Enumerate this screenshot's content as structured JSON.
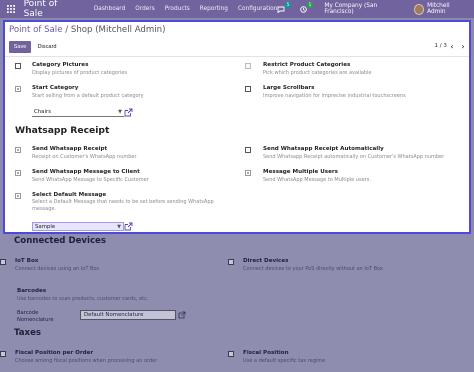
{
  "navbar": {
    "brand": "Point of Sale",
    "menu": [
      "Dashboard",
      "Orders",
      "Products",
      "Reporting",
      "Configuration"
    ],
    "messages_count": "5",
    "activities_count": "1",
    "company": "My Company (San Francisco)",
    "user": "Mitchell Admin"
  },
  "dialog": {
    "breadcrumb_parent": "Point of Sale",
    "breadcrumb_sep": "/",
    "breadcrumb_current": "Shop (Mitchell Admin)",
    "save_label": "Save",
    "discard_label": "Discard",
    "pager": "1 / 3",
    "settings": {
      "category_pictures": {
        "title": "Category Pictures",
        "desc": "Display pictures of product categories"
      },
      "restrict_categories": {
        "title": "Restrict Product Categories",
        "desc": "Pick which product categories are available"
      },
      "start_category": {
        "title": "Start Category",
        "desc": "Start selling from a default product category",
        "value": "Chairs"
      },
      "large_scrollbars": {
        "title": "Large Scrollbars",
        "desc": "Improve navigation for imprecise industrial touchscreens"
      }
    },
    "whatsapp": {
      "heading": "Whatsapp Receipt",
      "send_receipt": {
        "title": "Send Whatsapp Receipt",
        "desc": "Receipt on Customer's WhatsApp number"
      },
      "send_auto": {
        "title": "Send Whatsapp Receipt Automatically",
        "desc": "Send Whatsapp Receipt automatically on Customer's WhatsApp number"
      },
      "send_message": {
        "title": "Send Whatsapp Message to Client",
        "desc": "Send WhatsApp Message to Specific Customer"
      },
      "multiple_users": {
        "title": "Message Multiple Users",
        "desc": "Send WhatsApp Message to Multiple users."
      },
      "default_message": {
        "title": "Select Default Message",
        "desc": "Select a Default Message that needs to be set before sending WhatsApp message.",
        "value": "Sample"
      }
    }
  },
  "background": {
    "connected_devices_heading": "Connected Devices",
    "iot_box": {
      "title": "IoT Box",
      "desc": "Connect devices using an IoT Box"
    },
    "direct_devices": {
      "title": "Direct Devices",
      "desc": "Connect devices to your PoS directly without an IoT Box"
    },
    "barcodes": {
      "title": "Barcodes",
      "desc": "Use barcodes to scan products, customer cards, etc.",
      "nomenclature_label": "Barcode Nomenclature",
      "nomenclature_value": "Default Nomenclature"
    },
    "taxes_heading": "Taxes",
    "fiscal_position_per_order": {
      "title": "Fiscal Position per Order",
      "desc": "Choose among fiscal positions when processing an order"
    },
    "fiscal_position": {
      "title": "Fiscal Position",
      "desc": "Use a default specific tax regime"
    }
  }
}
